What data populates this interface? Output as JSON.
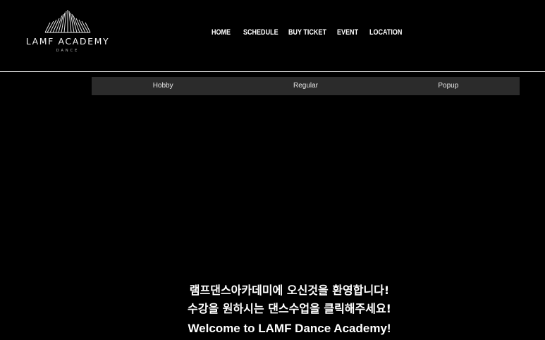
{
  "brand": {
    "name": "LAMF ACADEMY",
    "subtitle": "DANCE",
    "logo_icon": "crown-lines-icon"
  },
  "nav": {
    "items": [
      {
        "label": "HOME"
      },
      {
        "label": "SCHEDULE"
      },
      {
        "label": "BUY TICKET"
      },
      {
        "label": "EVENT"
      },
      {
        "label": "LOCATION"
      }
    ],
    "active": "SCHEDULE"
  },
  "tabs": [
    {
      "label": "Hobby"
    },
    {
      "label": "Regular"
    },
    {
      "label": "Popup"
    }
  ],
  "welcome": {
    "line1": "램프댄스아카데미에 오신것을 환영합니다!",
    "line2": "수강을 원하시는 댄스수업을 클릭해주세요!",
    "line3": "Welcome to LAMF Dance Academy!"
  },
  "colors": {
    "background": "#000000",
    "text": "#ffffff",
    "tab_bar": "#2b2b2b",
    "divider": "#d9d9d9"
  }
}
